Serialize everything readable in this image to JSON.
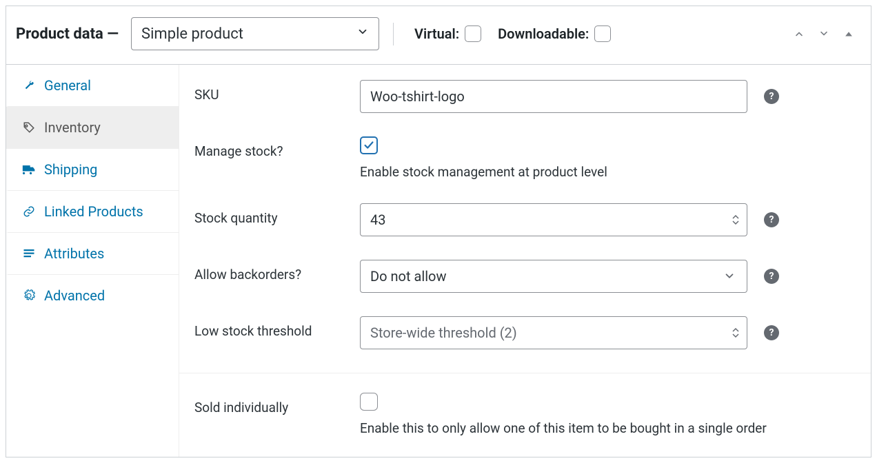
{
  "header": {
    "title": "Product data —",
    "type_value": "Simple product",
    "virtual_label": "Virtual:",
    "downloadable_label": "Downloadable:",
    "virtual_checked": false,
    "downloadable_checked": false
  },
  "sidebar": {
    "items": [
      {
        "label": "General",
        "icon": "wrench-icon"
      },
      {
        "label": "Inventory",
        "icon": "tag-icon"
      },
      {
        "label": "Shipping",
        "icon": "truck-icon"
      },
      {
        "label": "Linked Products",
        "icon": "link-icon"
      },
      {
        "label": "Attributes",
        "icon": "list-icon"
      },
      {
        "label": "Advanced",
        "icon": "gear-icon"
      }
    ],
    "active_index": 1
  },
  "fields": {
    "sku": {
      "label": "SKU",
      "value": "Woo-tshirt-logo"
    },
    "manage_stock": {
      "label": "Manage stock?",
      "checked": true,
      "desc": "Enable stock management at product level"
    },
    "stock_qty": {
      "label": "Stock quantity",
      "value": "43"
    },
    "backorders": {
      "label": "Allow backorders?",
      "value": "Do not allow"
    },
    "low_stock": {
      "label": "Low stock threshold",
      "placeholder": "Store-wide threshold (2)"
    },
    "sold_individually": {
      "label": "Sold individually",
      "checked": false,
      "desc": "Enable this to only allow one of this item to be bought in a single order"
    }
  },
  "icons": {
    "help": "?"
  }
}
